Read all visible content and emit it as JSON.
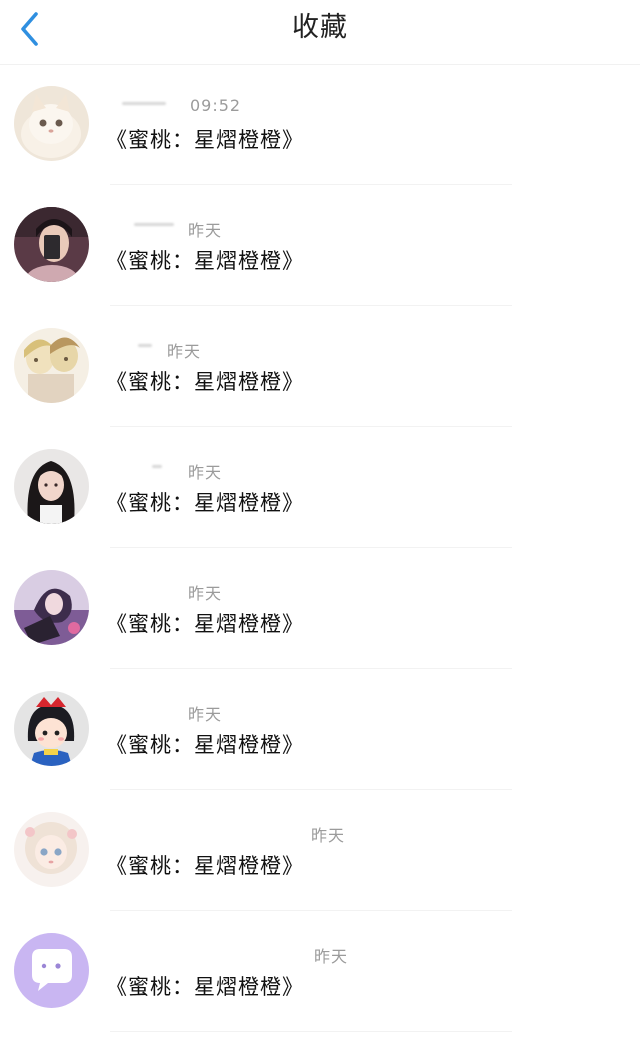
{
  "header": {
    "title": "收藏",
    "back_icon": "chevron-left-icon",
    "accent_color": "#2f8fe0"
  },
  "favorites": [
    {
      "time": "09:52",
      "text": "《蜜桃：星熠橙橙》",
      "avatar": "kitten-avatar"
    },
    {
      "time": "昨天",
      "text": "《蜜桃：星熠橙橙》",
      "avatar": "selfie-avatar"
    },
    {
      "time": "昨天",
      "text": "《蜜桃：星熠橙橙》",
      "avatar": "anime-couple-avatar"
    },
    {
      "time": "昨天",
      "text": "《蜜桃：星熠橙橙》",
      "avatar": "girl-portrait-avatar"
    },
    {
      "time": "昨天",
      "text": "《蜜桃：星熠橙橙》",
      "avatar": "anime-purple-avatar"
    },
    {
      "time": "昨天",
      "text": "《蜜桃：星熠橙橙》",
      "avatar": "cartoon-girl-avatar"
    },
    {
      "time": "昨天",
      "text": "《蜜桃：星熠橙橙》",
      "avatar": "doll-avatar"
    },
    {
      "time": "昨天",
      "text": "《蜜桃：星熠橙橙》",
      "avatar": "chat-bubble-avatar"
    }
  ]
}
